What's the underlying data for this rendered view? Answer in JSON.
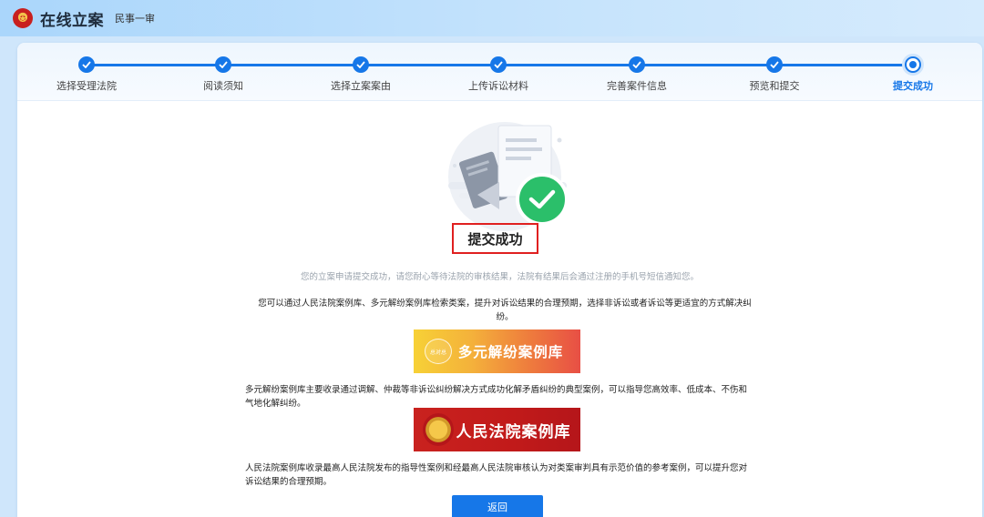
{
  "header": {
    "title": "在线立案",
    "subtitle": "民事一审"
  },
  "steps": [
    {
      "label": "选择受理法院",
      "done": true
    },
    {
      "label": "阅读须知",
      "done": true
    },
    {
      "label": "选择立案案由",
      "done": true
    },
    {
      "label": "上传诉讼材料",
      "done": true
    },
    {
      "label": "完善案件信息",
      "done": true
    },
    {
      "label": "预览和提交",
      "done": true
    },
    {
      "label": "提交成功",
      "current": true
    }
  ],
  "result": {
    "title": "提交成功",
    "notice": "您的立案申请提交成功，请您耐心等待法院的审核结果，法院有结果后会通过注册的手机号短信通知您。"
  },
  "info": {
    "intro": "您可以通过人民法院案例库、多元解纷案例库检索类案，提升对诉讼结果的合理预期，选择非诉讼或者诉讼等更适宜的方式解决纠纷。",
    "mediation_banner": "多元解纷案例库",
    "mediation_logo_text": "总对总",
    "mediation_desc": "多元解纷案例库主要收录通过调解、仲裁等非诉讼纠纷解决方式成功化解矛盾纠纷的典型案例，可以指导您高效率、低成本、不伤和气地化解纠纷。",
    "court_banner": "人民法院案例库",
    "court_desc": "人民法院案例库收录最高人民法院发布的指导性案例和经最高人民法院审核认为对类案审判具有示范价值的参考案例，可以提升您对诉讼结果的合理预期。"
  },
  "actions": {
    "back_label": "返回"
  },
  "colors": {
    "accent": "#1677e8",
    "success": "#2bbf6a",
    "highlight_border": "#e02020"
  }
}
